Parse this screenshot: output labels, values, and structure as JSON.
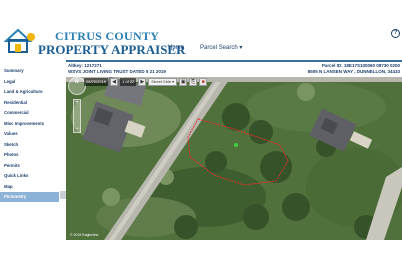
{
  "brand": {
    "line1": "CITRUS COUNTY",
    "line2": "PROPERTY APPRAISER",
    "colors": {
      "primary": "#1a5d93",
      "accent": "#f2b705",
      "secondary": "#2a7fb3"
    }
  },
  "nav": {
    "home": "Home",
    "parcel_search": "Parcel Search ▾",
    "help_icon": "?"
  },
  "sidebar": {
    "items": [
      {
        "label": "Summary"
      },
      {
        "label": "Legal"
      },
      {
        "label": "Land & Agriculture"
      },
      {
        "label": "Residential"
      },
      {
        "label": "Commercial"
      },
      {
        "label": "Misc Improvements"
      },
      {
        "label": "Values"
      },
      {
        "label": "Sketch"
      },
      {
        "label": "Photos"
      },
      {
        "label": "Permits"
      },
      {
        "label": "Quick Links"
      },
      {
        "label": "Map"
      },
      {
        "label": "Pictometry"
      }
    ],
    "active": "Pictometry"
  },
  "info": {
    "altkey": "Altkey: 1217271",
    "owner": "WSVS JOINT LIVING TRUST DATED 5 21 2019",
    "parcel_id": "Parcel ID: 18E17S100060 08730 0200",
    "address": "8505 N LANSEN WAY , DUNNELLON, 34433"
  },
  "map_toolbar": {
    "date": "08/20/2019",
    "page": "1 of 22",
    "select": "Street Side ▾",
    "prev": "◀",
    "next": "▶"
  },
  "compass": {
    "label": "N"
  },
  "zoom": {
    "plus": "+",
    "minus": "−"
  },
  "copyright": "© 2019 Eagleview"
}
